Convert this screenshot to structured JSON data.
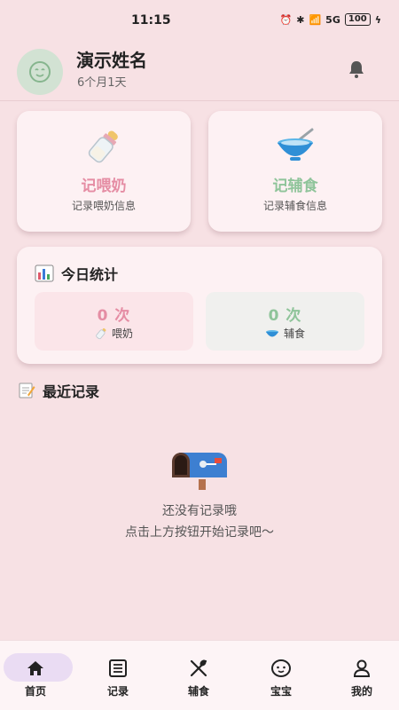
{
  "status_bar": {
    "time": "11:15",
    "network": "5G",
    "battery": "100"
  },
  "header": {
    "baby_name": "演示姓名",
    "baby_age": "6个月1天"
  },
  "actions": [
    {
      "title": "记喂奶",
      "subtitle": "记录喂奶信息",
      "icon": "baby-bottle-icon",
      "color": "#e58da4"
    },
    {
      "title": "记辅食",
      "subtitle": "记录辅食信息",
      "icon": "food-bowl-icon",
      "color": "#8fc49a"
    }
  ],
  "stats": {
    "title": "今日统计",
    "milk": {
      "count": "0 次",
      "label": "喂奶"
    },
    "food": {
      "count": "0 次",
      "label": "辅食"
    }
  },
  "recent": {
    "title": "最近记录",
    "empty_line1": "还没有记录哦",
    "empty_line2": "点击上方按钮开始记录吧～"
  },
  "nav": [
    {
      "label": "首页",
      "icon": "home-icon",
      "active": true
    },
    {
      "label": "记录",
      "icon": "list-icon",
      "active": false
    },
    {
      "label": "辅食",
      "icon": "utensils-icon",
      "active": false
    },
    {
      "label": "宝宝",
      "icon": "baby-face-icon",
      "active": false
    },
    {
      "label": "我的",
      "icon": "person-icon",
      "active": false
    }
  ],
  "colors": {
    "background": "#f7e1e4",
    "accent_pink": "#e58da4",
    "accent_green": "#8fc49a"
  }
}
